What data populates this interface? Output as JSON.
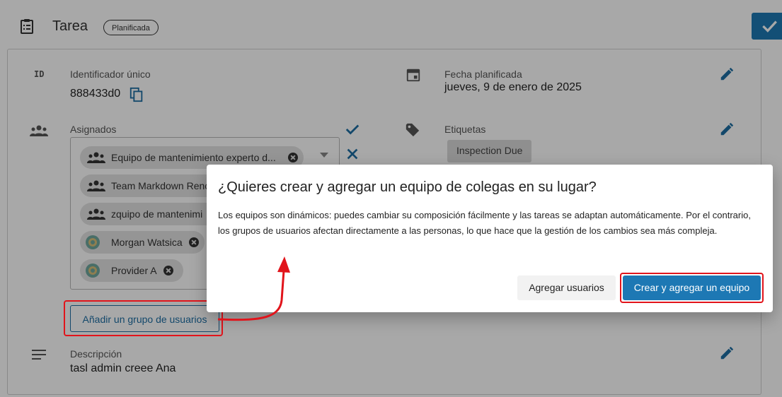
{
  "header": {
    "title": "Tarea",
    "status_badge": "Planificada"
  },
  "fields": {
    "id_label": "Identificador único",
    "id_value": "888433d0",
    "date_label": "Fecha planificada",
    "date_value": "jueves, 9 de enero de 2025",
    "assignees_label": "Asignados",
    "tags_label": "Etiquetas",
    "tag_1": "Inspection Due",
    "description_label": "Descripción",
    "description_value": "tasl admin creee Ana"
  },
  "assignees": [
    {
      "name": "Equipo de mantenimiento experto d...",
      "kind": "team"
    },
    {
      "name": "Team Markdown Renc",
      "kind": "team"
    },
    {
      "name": "zquipo de mantenimi",
      "kind": "team"
    },
    {
      "name": "Morgan Watsica",
      "kind": "user"
    },
    {
      "name": "Provider A",
      "kind": "user"
    }
  ],
  "add_group_button": "Añadir un grupo de usuarios",
  "dialog": {
    "title": "¿Quieres crear y agregar un equipo de colegas en su lugar?",
    "body": "Los equipos son dinámicos: puedes cambiar su composición fácilmente y las tareas se adaptan automáticamente. Por el contrario, los grupos de usuarios afectan directamente a las personas, lo que hace que la gestión de los cambios sea más compleja.",
    "secondary_button": "Agregar usuarios",
    "primary_button": "Crear y agregar un equipo"
  },
  "colors": {
    "accent": "#1d78b4",
    "highlight": "#e1141b"
  }
}
